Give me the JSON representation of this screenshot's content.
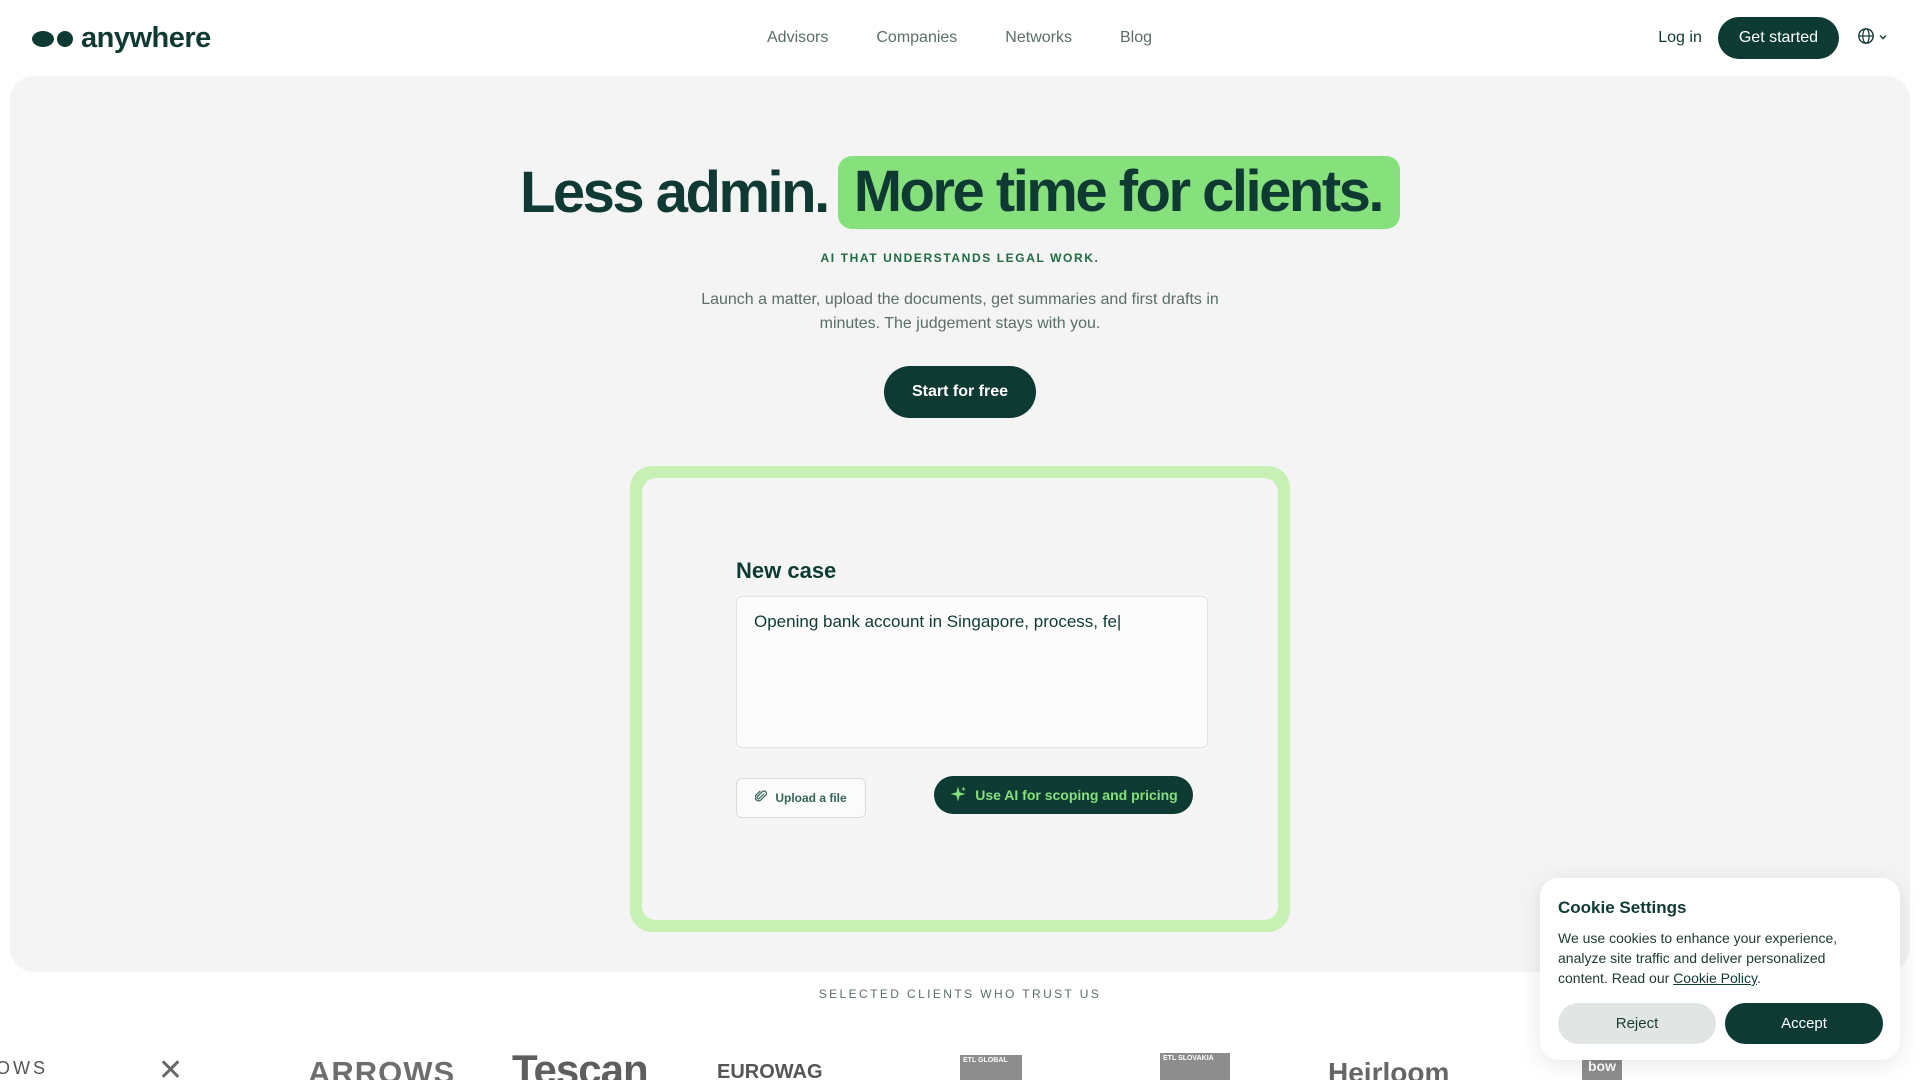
{
  "brand": {
    "name": "anywhere"
  },
  "nav": {
    "items": [
      {
        "label": "Advisors"
      },
      {
        "label": "Companies"
      },
      {
        "label": "Networks"
      },
      {
        "label": "Blog"
      }
    ],
    "login_label": "Log in",
    "cta_label": "Get started",
    "language_icon": "globe-icon"
  },
  "hero": {
    "headline_part1": "Less admin.",
    "headline_part2": "More time for clients.",
    "eyebrow": "AI THAT UNDERSTANDS LEGAL WORK.",
    "subtext": "Launch a matter, upload the documents, get summaries and first drafts in minutes. The judgement stays with you.",
    "cta_label": "Start for free"
  },
  "case_card": {
    "title": "New case",
    "input_value": "Opening bank account in Singapore, process, fe|",
    "upload_label": "Upload a file",
    "ai_label": "Use AI for scoping and pricing"
  },
  "clients": {
    "title": "SELECTED CLIENTS WHO TRUST US",
    "logos": [
      {
        "label": "OWS"
      },
      {
        "label": "✕"
      },
      {
        "label": "ARROWS"
      },
      {
        "label": "Tescan"
      },
      {
        "label": "EUROWAG"
      },
      {
        "label": "ETL GLOBAL"
      },
      {
        "label": "ETL SLOVAKIA"
      },
      {
        "label": "Heirloom"
      },
      {
        "label": "bow"
      }
    ]
  },
  "cookie": {
    "title": "Cookie Settings",
    "text": "We use cookies to enhance your experience, analyze site traffic and deliver personalized content. Read our ",
    "link_label": "Cookie Policy",
    "text_end": ".",
    "reject_label": "Reject",
    "accept_label": "Accept"
  },
  "colors": {
    "brand_dark": "#0d3b33",
    "accent_green": "#86e07c",
    "card_frame": "#c6f0b4",
    "hero_bg": "#f3f4f3"
  }
}
